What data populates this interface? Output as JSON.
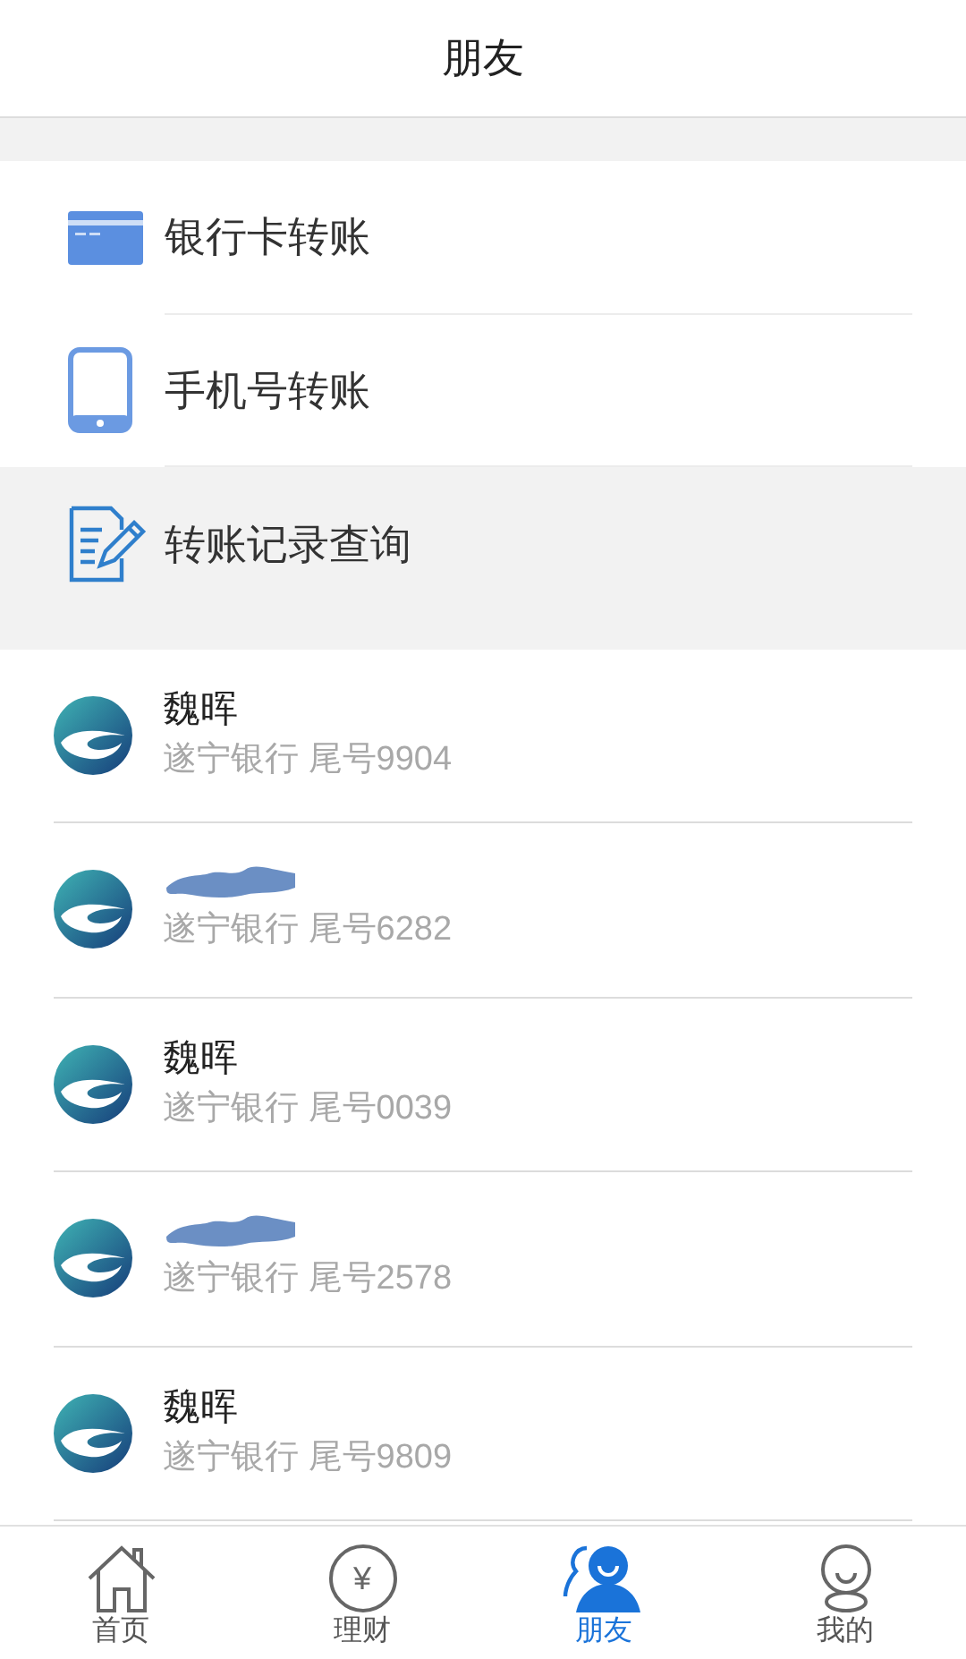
{
  "header": {
    "title": "朋友"
  },
  "menu": [
    {
      "kind": "card",
      "label": "银行卡转账",
      "selected": false
    },
    {
      "kind": "phone",
      "label": "手机号转账",
      "selected": false
    },
    {
      "kind": "record",
      "label": "转账记录查询",
      "selected": true
    }
  ],
  "contacts": [
    {
      "name": "魏晖",
      "redacted": false,
      "detail": "遂宁银行 尾号9904"
    },
    {
      "redacted": true,
      "detail": "遂宁银行 尾号6282"
    },
    {
      "name": "魏晖",
      "redacted": false,
      "detail": "遂宁银行 尾号0039"
    },
    {
      "redacted": true,
      "detail": "遂宁银行 尾号2578"
    },
    {
      "name": "魏晖",
      "redacted": false,
      "detail": "遂宁银行 尾号9809"
    }
  ],
  "tab_bar": [
    {
      "kind": "home",
      "label": "首页",
      "selected": false
    },
    {
      "kind": "finance",
      "label": "理财",
      "glyph": "¥",
      "selected": false
    },
    {
      "kind": "friends",
      "label": "朋友",
      "selected": true
    },
    {
      "kind": "me",
      "label": "我的",
      "selected": false
    }
  ]
}
